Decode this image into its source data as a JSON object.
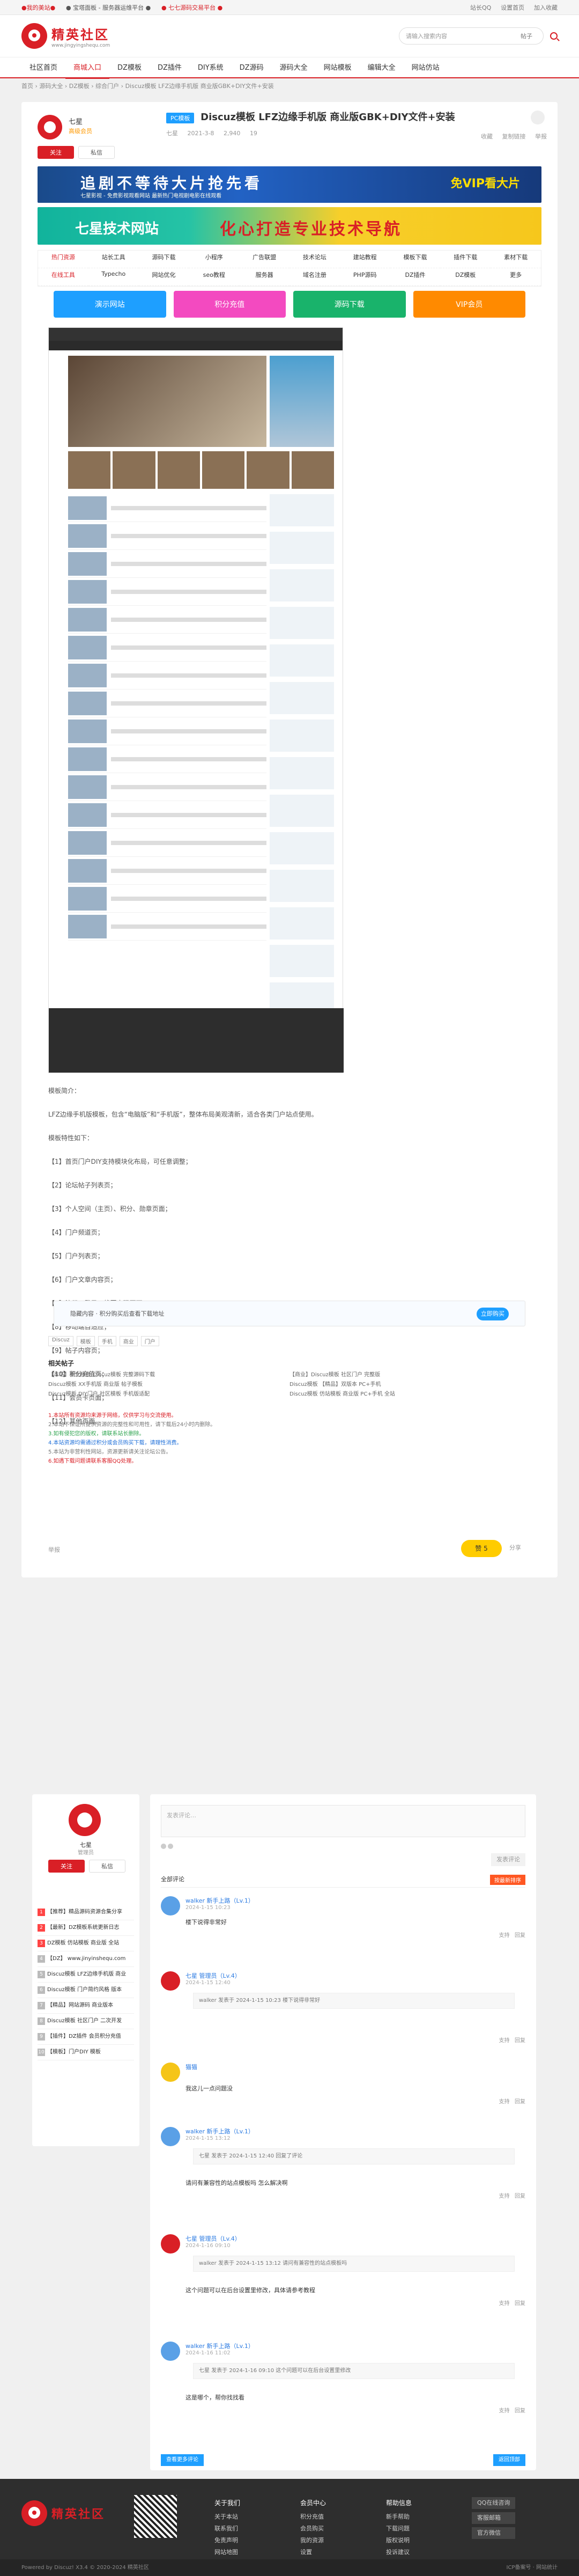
{
  "topbar": {
    "links": [
      "●我的美站●",
      "● 宝塔面板 - 服务器运维平台 ●",
      "● 七七源码交易平台 ●"
    ],
    "right": [
      "站长QQ",
      "设置首页",
      "加入收藏"
    ]
  },
  "header": {
    "logo": "精英社区",
    "logo_sub": "www.jingyingshequ.com",
    "search_placeholder": "请输入搜索内容",
    "search_select": "帖子"
  },
  "nav": [
    "社区首页",
    "商城入口",
    "DZ模板",
    "DZ插件",
    "DIY系统",
    "DZ源码",
    "源码大全",
    "网站模板",
    "编辑大全",
    "网站仿站"
  ],
  "breadcrumb": "首页 › 源码大全 › DZ模板 › 综合门户 › Discuz模板 LFZ边缘手机版 商业版GBK+DIY文件+安装",
  "author": {
    "name": "七星",
    "level": "高级会员",
    "follow": "关注",
    "message": "私信"
  },
  "post": {
    "tag": "PC模板",
    "title": "Discuz模板 LFZ边缘手机版 商业版GBK+DIY文件+安装",
    "meta": [
      "七星",
      "2021-3-8",
      "2,940",
      "19"
    ],
    "actions": [
      "收藏",
      "复制链接",
      "举报"
    ]
  },
  "banners": {
    "b1_main": "追剧不等待大片抢先看",
    "b1_sub": "七星影视 - 免费影视观看网站 最新热门电视剧电影在线观看",
    "b1_right": "免VIP看大片",
    "b2_main": "七星技术网站",
    "b2_slogan": "化心打造专业技术导航"
  },
  "link_grid": [
    "热门资源",
    "站长工具",
    "源码下载",
    "小程序",
    "广告联盟",
    "技术论坛",
    "建站教程",
    "模板下载",
    "插件下载",
    "素材下载",
    "在线工具",
    "Typecho",
    "网站优化",
    "seo教程",
    "服务器",
    "域名注册",
    "PHP源码",
    "DZ插件",
    "DZ模板",
    "更多"
  ],
  "quick_buttons": [
    {
      "label": "演示网站",
      "color": "#1e9fff"
    },
    {
      "label": "积分充值",
      "color": "#f34ac0"
    },
    {
      "label": "源码下载",
      "color": "#19b36b"
    },
    {
      "label": "VIP会员",
      "color": "#ff8a00"
    }
  ],
  "article": {
    "intro_head": "模板简介：",
    "intro": "LFZ边缘手机版模板，包含“电脑版”和“手机版”，整体布局美观清新，适合各类门户站点使用。",
    "features_head": "模板特性如下：",
    "features": [
      "【1】首页门户DIY支持模块化布局，可任意调整；",
      "【2】论坛帖子列表页；",
      "【3】个人空间（主页）、积分、勋章页面；",
      "【4】门户频道页；",
      "【5】门户列表页；",
      "【6】门户文章内容页；",
      "【7】注册、登录、找回密码页面；",
      "【8】移动端自适应；",
      "【9】帖子内容页；",
      "【10】积分充值页；",
      "【11】会员卡页面；",
      "【12】其他页面。"
    ]
  },
  "download": {
    "text": "隐藏内容 · 积分购买后查看下载地址",
    "button": "立即购买"
  },
  "tags": [
    "Discuz",
    "模板",
    "手机",
    "商业",
    "门户"
  ],
  "related_title": "相关帖子",
  "related": [
    "【本站】美化模板 Discuz模板 完整源码下载",
    "【商业】Discuz模板 社区门户 完整版",
    "Discuz模板 XX手机版 商业版 帖子模板",
    "Discuz模板 【精品】双版本 PC+手机",
    "Discuz模板 DIY门户 社区模板 手机版适配",
    "Discuz模板 仿站模板 商业版 PC+手机 全站"
  ],
  "notices": [
    {
      "text": "1.本站所有资源均来源于网络，仅供学习与交流使用。",
      "c": "r"
    },
    {
      "text": "2.本站不保证所提供资源的完整性和可用性，请下载后24小时内删除。",
      "c": ""
    },
    {
      "text": "3.如有侵犯您的版权，请联系站长删除。",
      "c": "g"
    },
    {
      "text": "4.本站资源均需通过积分或会员购买下载，请理性消费。",
      "c": "b"
    },
    {
      "text": "5.本站为非营利性网站，资源更新请关注论坛公告。",
      "c": ""
    },
    {
      "text": "6.如遇下载问题请联系客服QQ处理。",
      "c": "r"
    }
  ],
  "like": "赞",
  "like_count": "5",
  "share": "分享",
  "report": "举报",
  "side_user": {
    "name": "七星",
    "level": "管理员",
    "follow": "关注",
    "message": "私信"
  },
  "side_list": [
    "【推荐】精品源码资源合集分享",
    "【最新】DZ模板系统更新日志",
    "DZ模板 仿站模板 商业版 全站",
    "【DZ】 www.jinyinshequ.com",
    "Discuz模板 LFZ边缘手机版 商业",
    "Discuz模板 门户简约风格 版本",
    "【精品】网站源码 商业版本",
    "Discuz模板 社区门户 二次开发",
    "【插件】DZ插件 会员积分充值",
    "【模板】门户DIY 模板"
  ],
  "comment_box": {
    "placeholder": "发表评论…",
    "submit": "发表评论"
  },
  "comments_head": {
    "label": "全部评论",
    "sort": "按最新排序"
  },
  "comments": [
    {
      "who": "walker 新手上路（Lv.1）",
      "when": "2024-1-15 10:23",
      "body": "楼下说得非常好",
      "quote": ""
    },
    {
      "who": "七星 管理员（Lv.4）",
      "when": "2024-1-15 12:40",
      "body": "",
      "quote": "walker 发表于 2024-1-15 10:23 楼下说得非常好"
    },
    {
      "who": "猫猫",
      "when": "",
      "body": "我这儿一点问题没",
      "quote": ""
    },
    {
      "who": "walker 新手上路（Lv.1）",
      "when": "2024-1-15 13:12",
      "body": "请问有兼容性的站点模板吗 怎么解决啊",
      "quote": "七星 发表于 2024-1-15 12:40 回复了评论"
    },
    {
      "who": "七星 管理员（Lv.4）",
      "when": "2024-1-16 09:10",
      "body": "这个问题可以在后台设置里修改，具体请参考教程",
      "quote": "walker 发表于 2024-1-15 13:12 请问有兼容性的站点模板吗"
    },
    {
      "who": "walker 新手上路（Lv.1）",
      "when": "2024-1-16 11:02",
      "body": "这是哪个，帮你找找看",
      "quote": "七星 发表于 2024-1-16 09:10 这个问题可以在后台设置里修改"
    }
  ],
  "comment_actions": [
    "支持",
    "回复"
  ],
  "load_more": "查看更多评论",
  "to_top": "返回顶部",
  "footer": {
    "logo": "精英社区",
    "cols": [
      {
        "h": "关于我们",
        "items": [
          "关于本站",
          "联系我们",
          "免责声明",
          "网站地图"
        ]
      },
      {
        "h": "会员中心",
        "items": [
          "积分充值",
          "会员购买",
          "我的资源",
          "设置"
        ]
      },
      {
        "h": "帮助信息",
        "items": [
          "新手帮助",
          "下载问题",
          "版权说明",
          "投诉建议"
        ]
      }
    ],
    "contact": [
      "QQ在线咨询",
      "客服邮箱",
      "官方微信"
    ],
    "copyright": "Powered by Discuz! X3.4 © 2020-2024 精英社区",
    "icp": "ICP备案号 · 网站统计"
  }
}
